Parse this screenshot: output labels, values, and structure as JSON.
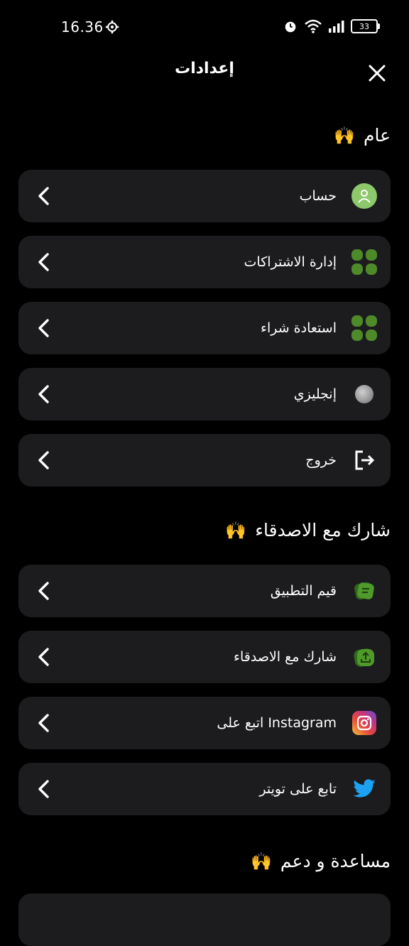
{
  "status_bar": {
    "time": "16.36",
    "battery": "33"
  },
  "header": {
    "title": "إعدادات"
  },
  "sections": [
    {
      "title": "عام",
      "emoji": "🙌"
    },
    {
      "title": "شارك مع الاصدقاء",
      "emoji": "🙌"
    },
    {
      "title": "مساعدة و دعم",
      "emoji": "🙌"
    }
  ],
  "general_items": [
    {
      "label": "حساب",
      "icon": "user-avatar-icon"
    },
    {
      "label": "إدارة الاشتراكات",
      "icon": "grid-icon"
    },
    {
      "label": "استعادة شراء",
      "icon": "grid-icon"
    },
    {
      "label": "إنجليزي",
      "icon": "globe-icon"
    },
    {
      "label": "خروج",
      "icon": "logout-icon"
    }
  ],
  "share_items": [
    {
      "label": "قيم التطبيق",
      "icon": "rate-icon"
    },
    {
      "label": "شارك مع الاصدقاء",
      "icon": "share-icon"
    },
    {
      "label": "Instagram اتبع على",
      "icon": "instagram-icon"
    },
    {
      "label": "تابع على تويتر",
      "icon": "twitter-icon"
    }
  ],
  "colors": {
    "background": "#000000",
    "card": "#1c1c1e",
    "accent_green": "#4f8a2a",
    "avatar_green": "#8dc86a",
    "twitter_blue": "#1da1f2"
  }
}
